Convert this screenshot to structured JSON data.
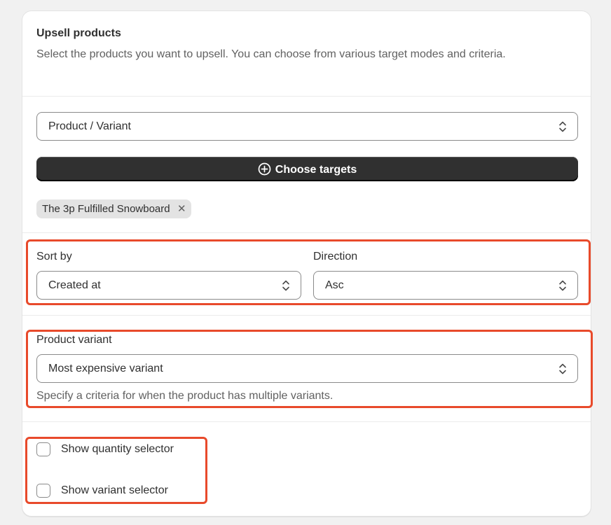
{
  "header": {
    "title": "Upsell products",
    "description": "Select the products you want to upsell. You can choose from various target modes and criteria."
  },
  "target_mode": {
    "value": "Product / Variant"
  },
  "choose_targets": {
    "label": "Choose targets",
    "icon": "plus-circle-icon"
  },
  "selected_targets": [
    {
      "label": "The 3p Fulfilled Snowboard",
      "remove_icon": "close-icon"
    }
  ],
  "sort": {
    "sort_by_label": "Sort by",
    "sort_by_value": "Created at",
    "direction_label": "Direction",
    "direction_value": "Asc"
  },
  "variant": {
    "label": "Product variant",
    "value": "Most expensive variant",
    "help": "Specify a criteria for when the product has multiple variants."
  },
  "options": {
    "show_quantity_label": "Show quantity selector",
    "show_quantity_checked": false,
    "show_variant_label": "Show variant selector",
    "show_variant_checked": false
  },
  "colors": {
    "highlight": "#e84a2b",
    "primary_button": "#303030",
    "tag_background": "#e3e3e3"
  }
}
